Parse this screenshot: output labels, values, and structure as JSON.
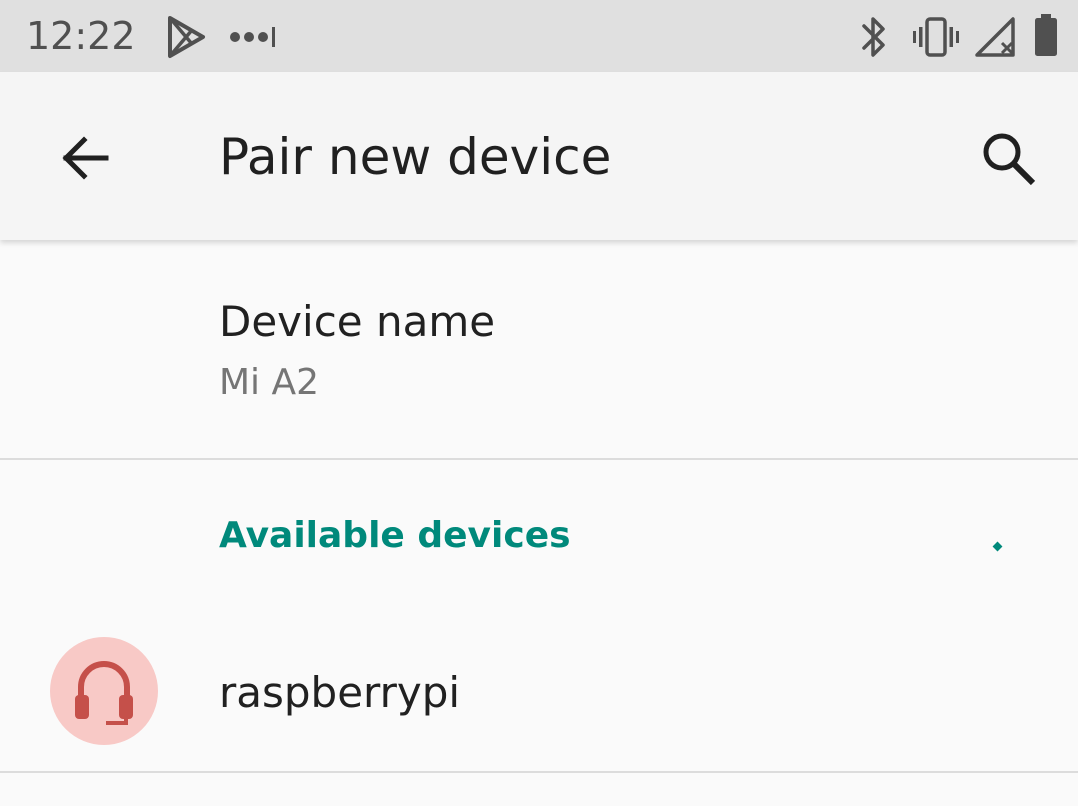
{
  "status_bar": {
    "time": "12:22",
    "icons": [
      "play-store-icon",
      "more-notifications-icon",
      "bluetooth-icon",
      "vibrate-icon",
      "no-signal-icon",
      "battery-icon"
    ]
  },
  "app_bar": {
    "back_icon": "arrow-back-icon",
    "title": "Pair new device",
    "search_icon": "search-icon"
  },
  "device_name": {
    "title": "Device name",
    "summary": "Mi A2"
  },
  "available_devices": {
    "header": "Available devices",
    "items": [
      {
        "name": "raspberrypi",
        "icon": "headset-icon",
        "icon_color": "#c5504a",
        "icon_bg": "#f8c9c6"
      }
    ]
  },
  "colors": {
    "accent": "#00897b",
    "status_bar_bg": "#e0e0e0",
    "app_bar_bg": "#f5f5f5",
    "background": "#fafafa"
  }
}
